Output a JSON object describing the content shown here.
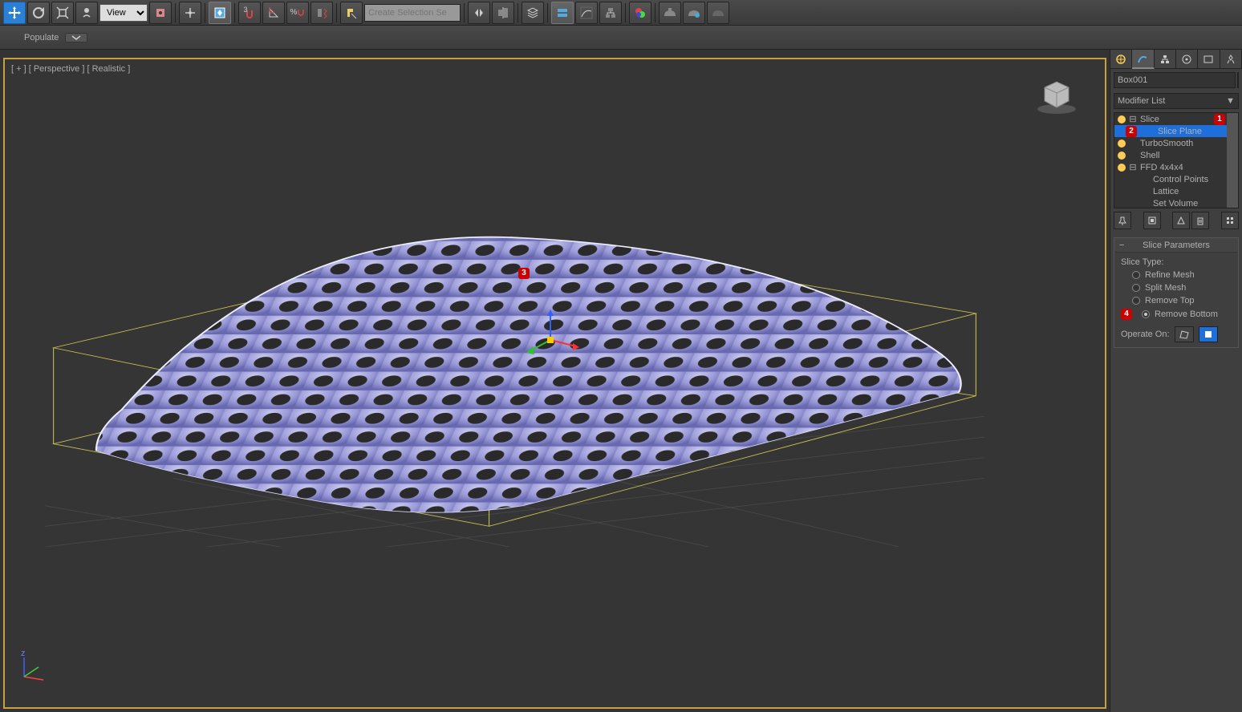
{
  "toolbar": {
    "view_dropdown": "View",
    "selection_set_placeholder": "Create Selection Se",
    "snap_label": "3"
  },
  "ribbon": {
    "populate": "Populate"
  },
  "viewport": {
    "label": "[ + ] [ Perspective ] [ Realistic ]"
  },
  "annotations": {
    "n1": "1",
    "n2": "2",
    "n3": "3",
    "n4": "4"
  },
  "cmdpanel": {
    "object_name": "Box001",
    "modifier_list_label": "Modifier List",
    "stack": {
      "slice": "Slice",
      "slice_plane": "Slice Plane",
      "turbosmooth": "TurboSmooth",
      "shell": "Shell",
      "ffd": "FFD 4x4x4",
      "control_points": "Control Points",
      "lattice": "Lattice",
      "set_volume": "Set Volume"
    },
    "rollout": {
      "title": "Slice Parameters",
      "slice_type": "Slice Type:",
      "refine": "Refine Mesh",
      "split": "Split Mesh",
      "remove_top": "Remove Top",
      "remove_bottom": "Remove Bottom",
      "operate_on": "Operate On:"
    }
  }
}
